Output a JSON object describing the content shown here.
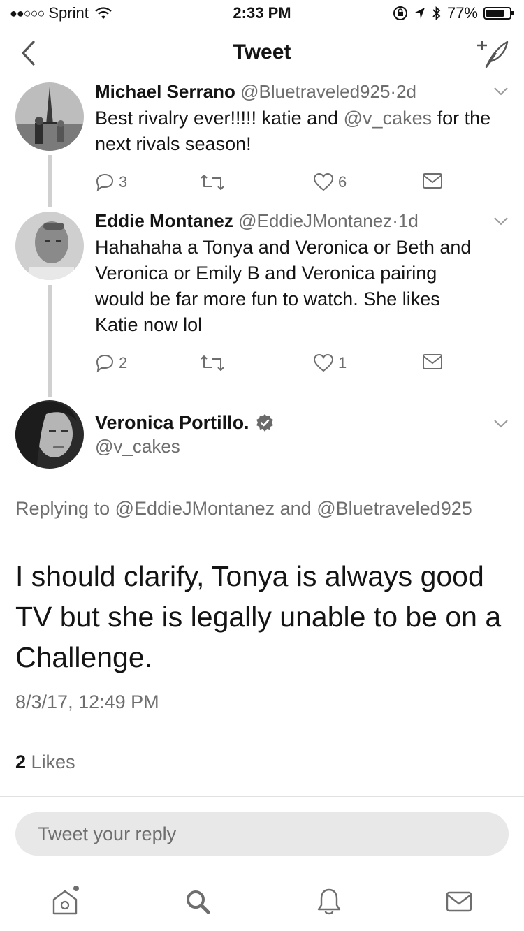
{
  "status_bar": {
    "carrier": "Sprint",
    "time": "2:33 PM",
    "battery": "77%",
    "battery_level": 0.77
  },
  "nav": {
    "title": "Tweet"
  },
  "replies": [
    {
      "name": "Michael Serrano",
      "handle": "@Bluetraveled925",
      "age": "2d",
      "text_plain": "Best rivalry ever!!!!! katie and ",
      "text_mention": "@v_cakes",
      "text_tail": " for the next rivals season!",
      "replies_count": "3",
      "likes_count": "6"
    },
    {
      "name": "Eddie Montanez",
      "handle": "@EddieJMontanez",
      "age": "1d",
      "text": "Hahahaha a Tonya and Veronica or Beth and Veronica or Emily B and Veronica pairing would be far more fun to watch. She likes Katie now lol",
      "replies_count": "2",
      "likes_count": "1"
    }
  ],
  "main_tweet": {
    "name": "Veronica Portillo.",
    "handle": "@v_cakes",
    "replying_label": "Replying to",
    "replying_users": "@EddieJMontanez and @Bluetraveled925",
    "text": "I should clarify, Tonya is always good TV but she is legally unable to be on a Challenge.",
    "timestamp": "8/3/17, 12:49 PM",
    "likes_count": "2",
    "likes_label": "Likes"
  },
  "reply_box": {
    "placeholder": "Tweet your reply"
  },
  "tabs": [
    "home",
    "search",
    "notifications",
    "messages"
  ]
}
